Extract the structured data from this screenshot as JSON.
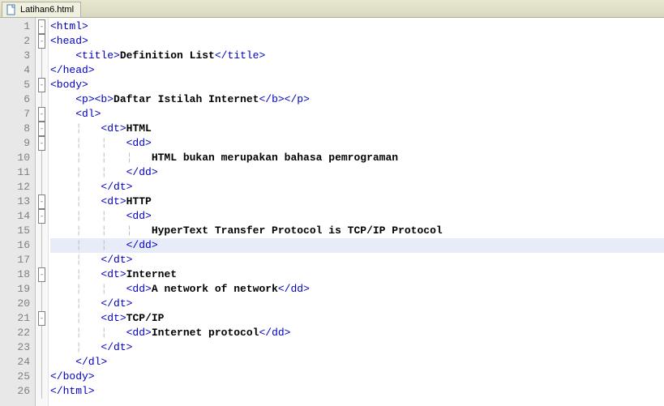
{
  "tab": {
    "filename": "Latihan6.html"
  },
  "editor": {
    "highlighted_line": 16,
    "lines": [
      {
        "num": 1,
        "fold": "open",
        "indent": "",
        "segments": [
          {
            "t": "tag",
            "v": "<html>"
          }
        ]
      },
      {
        "num": 2,
        "fold": "open",
        "indent": "",
        "segments": [
          {
            "t": "tag",
            "v": "<head>"
          }
        ]
      },
      {
        "num": 3,
        "fold": "line",
        "indent": "    ",
        "segments": [
          {
            "t": "tag",
            "v": "<title>"
          },
          {
            "t": "bold",
            "v": "Definition List"
          },
          {
            "t": "tag",
            "v": "</title>"
          }
        ]
      },
      {
        "num": 4,
        "fold": "line",
        "indent": "",
        "segments": [
          {
            "t": "tag",
            "v": "</head>"
          }
        ]
      },
      {
        "num": 5,
        "fold": "open",
        "indent": "",
        "segments": [
          {
            "t": "tag",
            "v": "<body>"
          }
        ]
      },
      {
        "num": 6,
        "fold": "line",
        "indent": "    ",
        "segments": [
          {
            "t": "tag",
            "v": "<p><b>"
          },
          {
            "t": "bold",
            "v": "Daftar Istilah Internet"
          },
          {
            "t": "tag",
            "v": "</b></p>"
          }
        ]
      },
      {
        "num": 7,
        "fold": "open",
        "indent": "    ",
        "segments": [
          {
            "t": "tag",
            "v": "<dl>"
          }
        ]
      },
      {
        "num": 8,
        "fold": "open",
        "indent": "        ",
        "segments": [
          {
            "t": "tag",
            "v": "<dt>"
          },
          {
            "t": "bold",
            "v": "HTML"
          }
        ]
      },
      {
        "num": 9,
        "fold": "open",
        "indent": "            ",
        "segments": [
          {
            "t": "tag",
            "v": "<dd>"
          }
        ]
      },
      {
        "num": 10,
        "fold": "line",
        "indent": "                ",
        "segments": [
          {
            "t": "bold",
            "v": "HTML bukan merupakan bahasa pemrograman"
          }
        ]
      },
      {
        "num": 11,
        "fold": "line",
        "indent": "            ",
        "segments": [
          {
            "t": "tag",
            "v": "</dd>"
          }
        ]
      },
      {
        "num": 12,
        "fold": "line",
        "indent": "        ",
        "segments": [
          {
            "t": "tag",
            "v": "</dt>"
          }
        ]
      },
      {
        "num": 13,
        "fold": "open",
        "indent": "        ",
        "segments": [
          {
            "t": "tag",
            "v": "<dt>"
          },
          {
            "t": "bold",
            "v": "HTTP"
          }
        ]
      },
      {
        "num": 14,
        "fold": "open",
        "indent": "            ",
        "segments": [
          {
            "t": "tag",
            "v": "<dd>"
          }
        ]
      },
      {
        "num": 15,
        "fold": "line",
        "indent": "                ",
        "segments": [
          {
            "t": "bold",
            "v": "HyperText Transfer Protocol is TCP/IP Protocol"
          }
        ]
      },
      {
        "num": 16,
        "fold": "line",
        "indent": "            ",
        "segments": [
          {
            "t": "tag",
            "v": "</dd>"
          }
        ]
      },
      {
        "num": 17,
        "fold": "line",
        "indent": "        ",
        "segments": [
          {
            "t": "tag",
            "v": "</dt>"
          }
        ]
      },
      {
        "num": 18,
        "fold": "open",
        "indent": "        ",
        "segments": [
          {
            "t": "tag",
            "v": "<dt>"
          },
          {
            "t": "bold",
            "v": "Internet"
          }
        ]
      },
      {
        "num": 19,
        "fold": "line",
        "indent": "            ",
        "segments": [
          {
            "t": "tag",
            "v": "<dd>"
          },
          {
            "t": "bold",
            "v": "A network of network"
          },
          {
            "t": "tag",
            "v": "</dd>"
          }
        ]
      },
      {
        "num": 20,
        "fold": "line",
        "indent": "        ",
        "segments": [
          {
            "t": "tag",
            "v": "</dt>"
          }
        ]
      },
      {
        "num": 21,
        "fold": "open",
        "indent": "        ",
        "segments": [
          {
            "t": "tag",
            "v": "<dt>"
          },
          {
            "t": "bold",
            "v": "TCP/IP"
          }
        ]
      },
      {
        "num": 22,
        "fold": "line",
        "indent": "            ",
        "segments": [
          {
            "t": "tag",
            "v": "<dd>"
          },
          {
            "t": "bold",
            "v": "Internet protocol"
          },
          {
            "t": "tag",
            "v": "</dd>"
          }
        ]
      },
      {
        "num": 23,
        "fold": "line",
        "indent": "        ",
        "segments": [
          {
            "t": "tag",
            "v": "</dt>"
          }
        ]
      },
      {
        "num": 24,
        "fold": "line",
        "indent": "    ",
        "segments": [
          {
            "t": "tag",
            "v": "</dl>"
          }
        ]
      },
      {
        "num": 25,
        "fold": "line",
        "indent": "",
        "segments": [
          {
            "t": "tag",
            "v": "</body>"
          }
        ]
      },
      {
        "num": 26,
        "fold": "line",
        "indent": "",
        "segments": [
          {
            "t": "tag",
            "v": "</html>"
          }
        ]
      }
    ]
  }
}
